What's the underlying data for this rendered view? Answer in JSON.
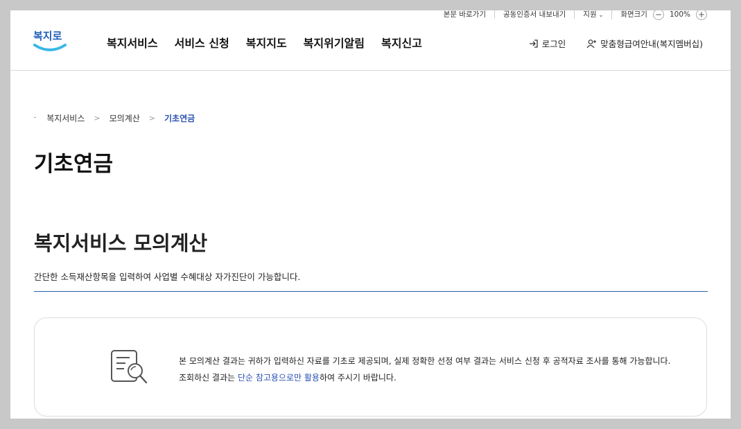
{
  "utility": {
    "skip_link": "본문 바로가기",
    "cert_export": "공동인증서 내보내기",
    "support": "지원",
    "font_size_label": "화면크기",
    "zoom_minus": "−",
    "zoom_value": "100%",
    "zoom_plus": "+"
  },
  "logo": {
    "text": "복지로",
    "colors": {
      "primary": "#1f5fb8",
      "accent": "#39b7e8"
    }
  },
  "gnb": [
    {
      "label": "복지서비스"
    },
    {
      "label": "서비스 신청"
    },
    {
      "label": "복지지도"
    },
    {
      "label": "복지위기알림"
    },
    {
      "label": "복지신고"
    }
  ],
  "header_right": {
    "login": "로그인",
    "membership": "맞춤형급여안내(복지멤버십)"
  },
  "breadcrumb": {
    "items": [
      "복지서비스",
      "모의계산"
    ],
    "current": "기초연금"
  },
  "page_title": "기초연금",
  "section": {
    "title": "복지서비스 모의계산",
    "description": "간단한 소득재산항목을 입력하여 사업별 수혜대상 자가진단이 가능합니다."
  },
  "notice": {
    "icon": "document-search-icon",
    "text_before": "본 모의계산 결과는 귀하가 입력하신 자료를 기초로 제공되며, 실제 정확한 선정 여부 결과는 서비스 신청 후 공적자료 조사를 통해 가능합니다. 조회하신 결과는 ",
    "text_highlight": "단순 참고용으로만 활용",
    "text_after": "하여 주시기 바랍니다."
  },
  "colors": {
    "accent": "#2a4fb0",
    "divider": "#2a5ea8",
    "frame_bg": "#c8c8c8"
  }
}
